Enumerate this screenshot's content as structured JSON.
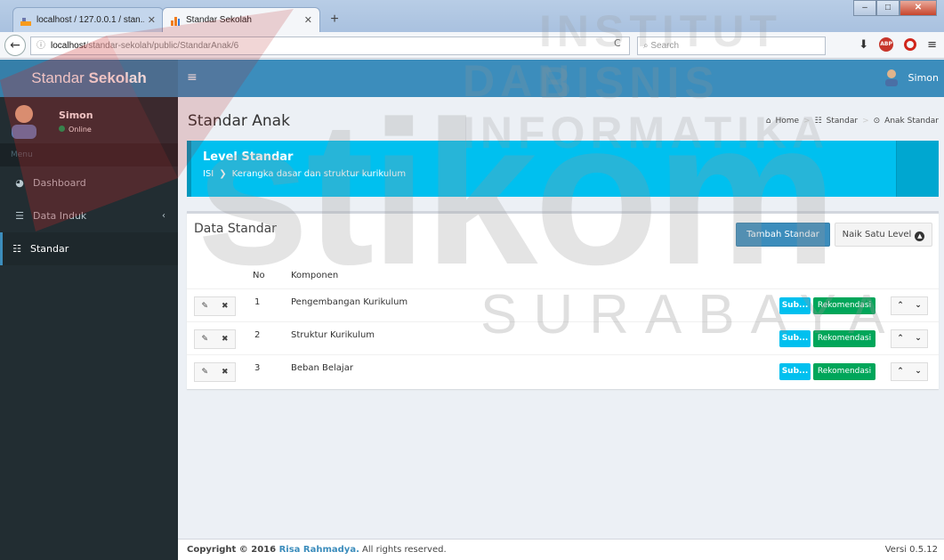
{
  "browser": {
    "tabs": [
      {
        "title": "localhost / 127.0.0.1 / stan...",
        "active": false
      },
      {
        "title": "Standar Sekolah",
        "active": true
      }
    ],
    "url_host": "localhost",
    "url_path": "/standar-sekolah/public/StandarAnak/6",
    "search_placeholder": "Search"
  },
  "app": {
    "logo_light": "Standar ",
    "logo_bold": "Sekolah",
    "header_user": "Simon"
  },
  "sidebar": {
    "user_name": "Simon",
    "user_status": "Online",
    "menu_header": "Menu",
    "items": [
      {
        "label": "Dashboard",
        "icon": "dashboard-icon"
      },
      {
        "label": "Data Induk",
        "icon": "database-icon"
      },
      {
        "label": "Standar",
        "icon": "sliders-icon"
      }
    ]
  },
  "content": {
    "title": "Standar Anak",
    "breadcrumb": [
      "Home",
      "Standar",
      "Anak Standar"
    ],
    "callout_title": "Level Standar",
    "callout_path": [
      "ISI",
      "Kerangka dasar dan struktur kurikulum"
    ],
    "box_title": "Data Standar",
    "add_button": "Tambah Standar",
    "up_button": "Naik Satu Level",
    "columns": [
      "No",
      "Komponen"
    ],
    "rows": [
      {
        "no": "1",
        "name": "Pengembangan Kurikulum",
        "sub": "Sub...",
        "rek": "Rekomendasi"
      },
      {
        "no": "2",
        "name": "Struktur Kurikulum",
        "sub": "Sub...",
        "rek": "Rekomendasi"
      },
      {
        "no": "3",
        "name": "Beban Belajar",
        "sub": "Sub...",
        "rek": "Rekomendasi"
      }
    ]
  },
  "footer": {
    "copyright_prefix": "Copyright © 2016 ",
    "author": "Risa Rahmadya.",
    "rights": " All rights reserved.",
    "version": "Versi 0.5.12"
  },
  "watermark": {
    "line1": "INSTITUT BISNIS",
    "line2": "DAN INFORMATIKA",
    "big": "stikom",
    "city": "SURABAYA"
  },
  "colors": {
    "primary": "#3c8dbc",
    "logo_bg": "#367fa9",
    "sidebar_bg": "#222d32",
    "callout": "#00c0ef",
    "success": "#00a65a"
  }
}
